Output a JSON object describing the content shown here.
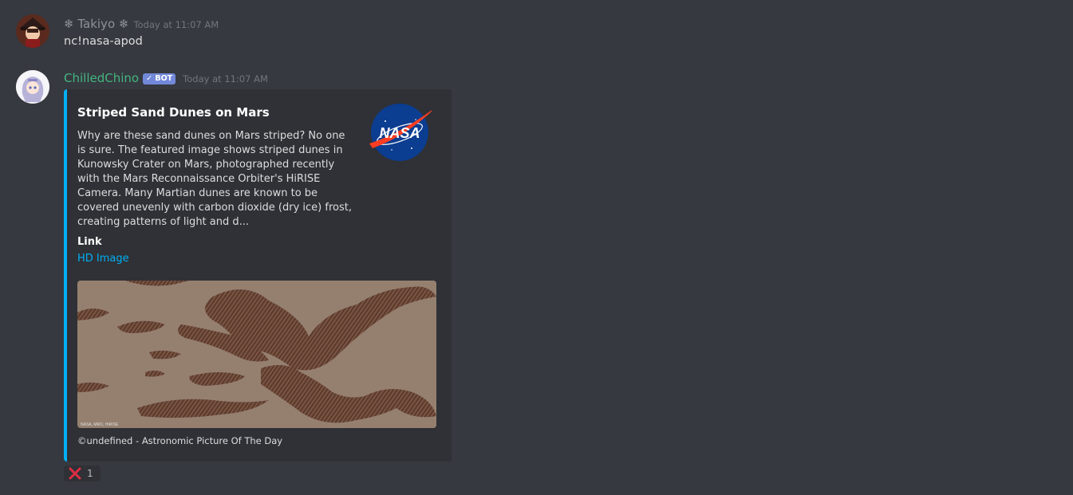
{
  "messages": [
    {
      "username": "❄ Takiyo ❄",
      "username_color": "#8e9297",
      "timestamp": "Today at 11:07 AM",
      "content": "nc!nasa-apod"
    },
    {
      "username": "ChilledChino",
      "username_color": "#43b581",
      "bot_tag": "✓ BOT",
      "timestamp": "Today at 11:07 AM",
      "embed": {
        "accent_color": "#00b0f4",
        "title": "Striped Sand Dunes on Mars",
        "description": "Why are these sand dunes on Mars striped? No one is sure. The featured image shows striped dunes in Kunowsky Crater on Mars, photographed recently with the Mars Reconnaissance Orbiter's HiRISE Camera. Many Martian dunes are known to be covered unevenly with carbon dioxide (dry ice) frost, creating patterns of light and d...",
        "field_name": "Link",
        "field_value": "HD Image",
        "thumbnail_text": "NASA",
        "image_credit": "NASA, MRO, HiRISE",
        "footer": "©undefined - Astronomic Picture Of The Day"
      },
      "reaction": {
        "emoji": "cross-mark-icon",
        "count": "1",
        "color": "#dd2e44"
      }
    }
  ]
}
